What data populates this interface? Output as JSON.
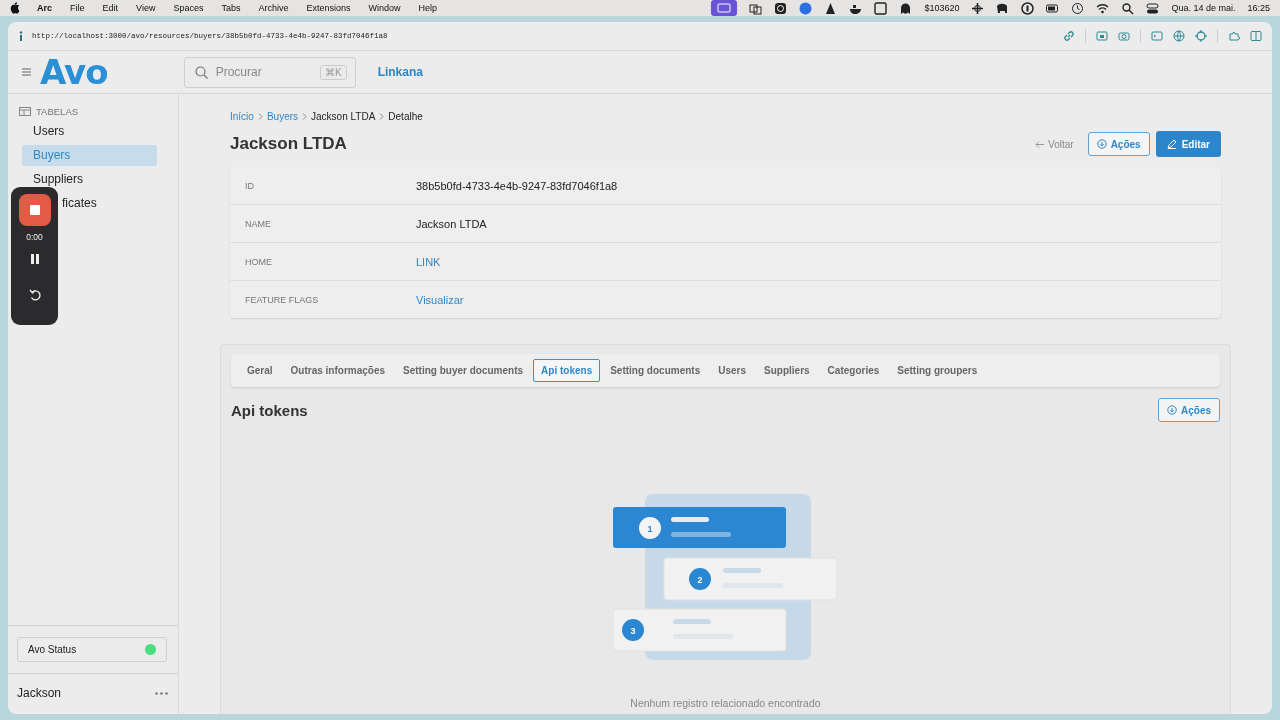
{
  "menubar": {
    "app": "Arc",
    "menus": [
      "File",
      "Edit",
      "View",
      "Spaces",
      "Tabs",
      "Archive",
      "Extensions",
      "Window",
      "Help"
    ],
    "status_text": "$103620",
    "date": "Qua. 14 de mai.",
    "time": "16:25"
  },
  "browser": {
    "url": "http://localhost:3000/avo/resources/buyers/38b5b0fd-4733-4e4b-9247-83fd7046f1a8"
  },
  "header": {
    "logo": "Avo",
    "search": {
      "placeholder": "Procurar",
      "shortcut": "⌘K"
    },
    "workspace": "Linkana"
  },
  "sidebar": {
    "section": "TABELAS",
    "items": [
      {
        "label": "Users",
        "selected": false,
        "covered": false
      },
      {
        "label": "Buyers",
        "selected": true,
        "covered": false
      },
      {
        "label": "Suppliers",
        "selected": false,
        "covered": false
      },
      {
        "label": "ficates",
        "selected": false,
        "covered": true
      }
    ],
    "status": {
      "label": "Avo Status",
      "color": "#4ade80"
    },
    "user": "Jackson"
  },
  "recorder": {
    "time": "0:00"
  },
  "breadcrumbs": [
    {
      "label": "Início",
      "kind": "link"
    },
    {
      "label": "Buyers",
      "kind": "link"
    },
    {
      "label": "Jackson LTDA",
      "kind": "text"
    },
    {
      "label": "Detalhe",
      "kind": "text"
    }
  ],
  "title": "Jackson LTDA",
  "actions": {
    "back": "Voltar",
    "menu": "Ações",
    "edit": "Editar"
  },
  "fields": [
    {
      "label": "ID",
      "value": "38b5b0fd-4733-4e4b-9247-83fd7046f1a8",
      "kind": "text"
    },
    {
      "label": "NAME",
      "value": "Jackson LTDA",
      "kind": "text"
    },
    {
      "label": "HOME",
      "value": "LINK",
      "kind": "link"
    },
    {
      "label": "FEATURE FLAGS",
      "value": "Visualizar",
      "kind": "link"
    }
  ],
  "tabs": [
    {
      "label": "Geral",
      "selected": false
    },
    {
      "label": "Outras informações",
      "selected": false
    },
    {
      "label": "Setting buyer documents",
      "selected": false
    },
    {
      "label": "Api tokens",
      "selected": true
    },
    {
      "label": "Setting documents",
      "selected": false
    },
    {
      "label": "Users",
      "selected": false
    },
    {
      "label": "Suppliers",
      "selected": false
    },
    {
      "label": "Categories",
      "selected": false
    },
    {
      "label": "Setting groupers",
      "selected": false
    }
  ],
  "section": {
    "title": "Api tokens",
    "menu": "Ações",
    "steps": [
      "1",
      "2",
      "3"
    ],
    "empty_text": "Nenhum registro relacionado encontrado"
  }
}
